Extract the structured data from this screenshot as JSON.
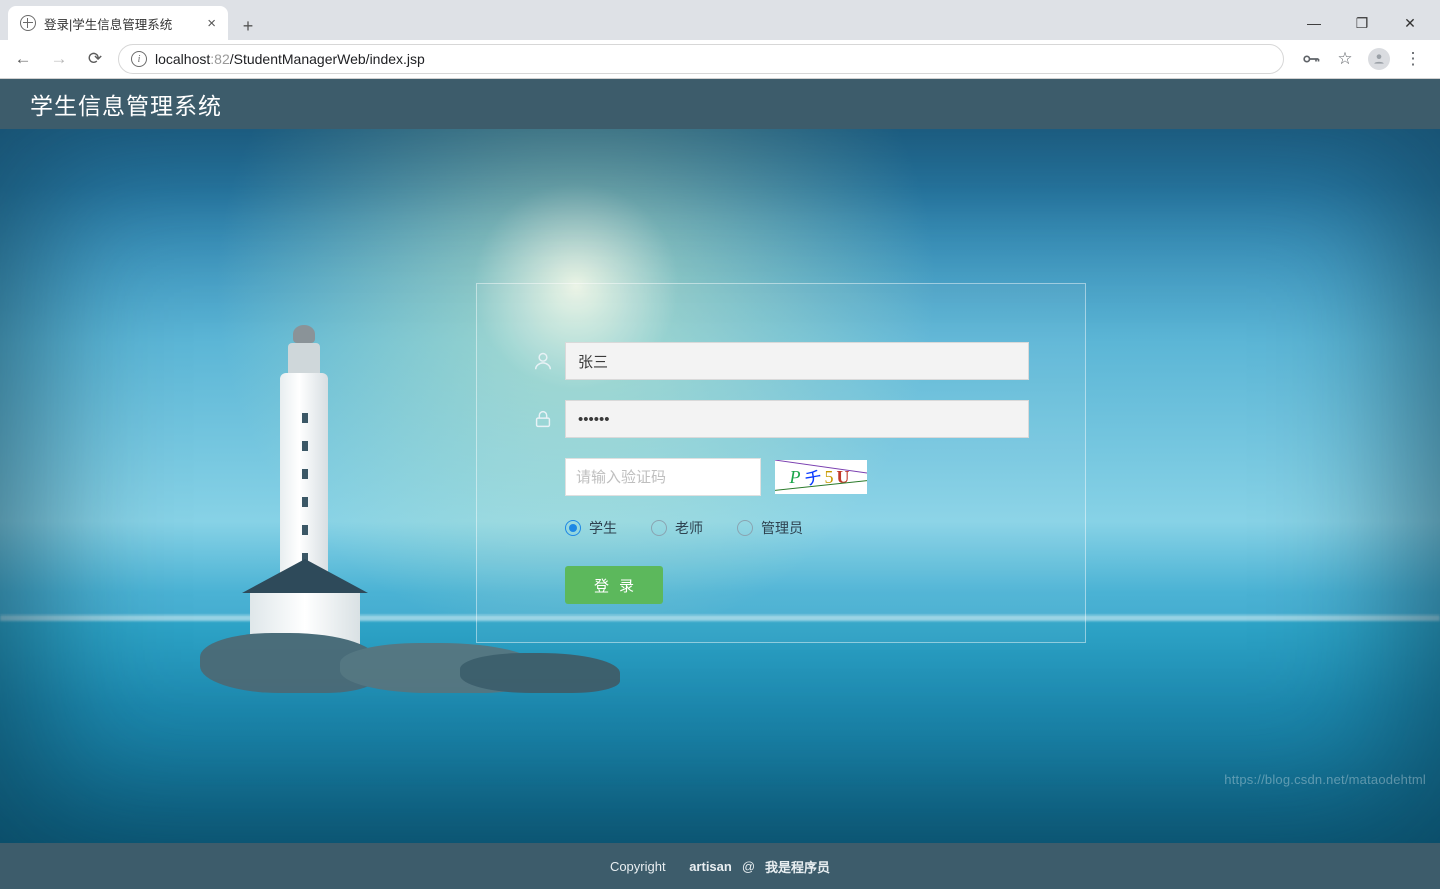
{
  "browser": {
    "tab_title": "登录|学生信息管理系统",
    "url": {
      "host": "localhost",
      "port": ":82",
      "path": "/StudentManagerWeb/index.jsp"
    }
  },
  "header": {
    "title": "学生信息管理系统"
  },
  "login": {
    "username_value": "张三",
    "password_value": "••••••",
    "captcha_placeholder": "请输入验证码",
    "captcha_chars": {
      "c1": "P",
      "c2": "チ",
      "c3": "5",
      "c4": "U"
    },
    "roles": {
      "student": "学生",
      "teacher": "老师",
      "admin": "管理员",
      "selected": "student"
    },
    "submit_label": "登录"
  },
  "footer": {
    "copyright_label": "Copyright",
    "author": "artisan",
    "at": "@",
    "tagline": "我是程序员"
  },
  "watermark": "https://blog.csdn.net/mataodehtml"
}
